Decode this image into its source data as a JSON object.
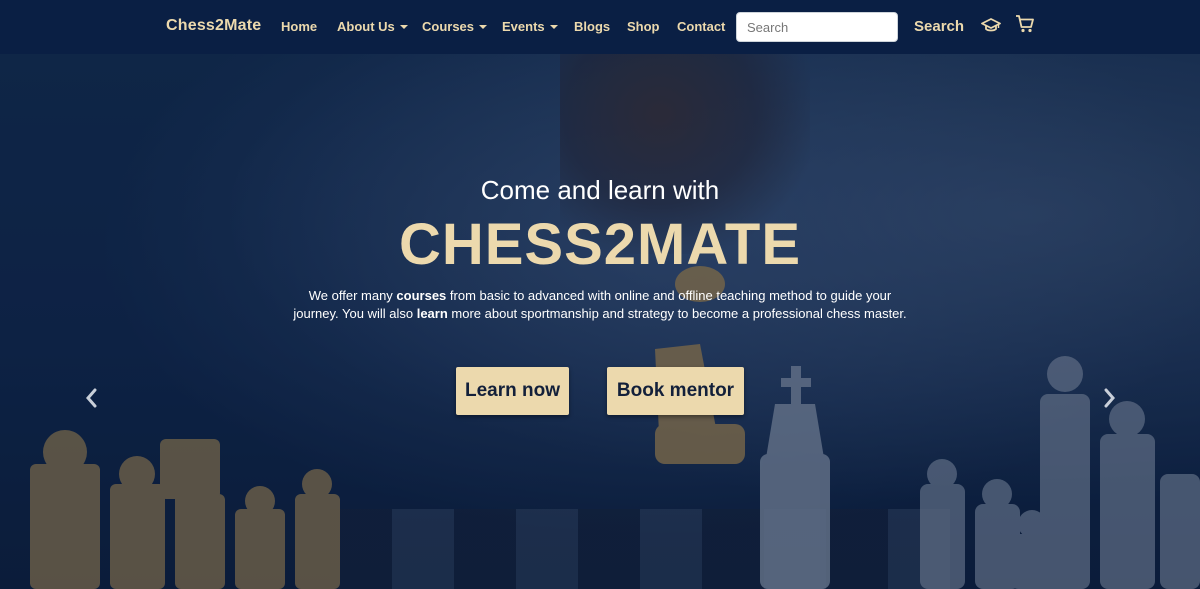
{
  "navbar": {
    "brand": "Chess2Mate",
    "items": [
      {
        "label": "Home"
      },
      {
        "label": "About Us"
      },
      {
        "label": "Courses"
      },
      {
        "label": "Events"
      },
      {
        "label": "Blogs"
      },
      {
        "label": "Shop"
      },
      {
        "label": "Contact"
      }
    ],
    "search": {
      "placeholder": "Search",
      "button_label": "Search"
    },
    "icons": [
      "graduation-cap-icon",
      "cart-icon"
    ]
  },
  "hero": {
    "subtitle": "Come and learn with",
    "title": "CHESS2MATE",
    "description": {
      "part1": "We offer many ",
      "bold1": "courses",
      "part2": " from basic to advanced with online and offline teaching method to guide your journey. You will also ",
      "bold2": "learn",
      "part3": " more about sportmanship and strategy to become a professional chess master."
    },
    "buttons": {
      "learn_now": "Learn now",
      "book_mentor": "Book mentor"
    },
    "carousel": {
      "prev_icon": "chevron-left-icon",
      "next_icon": "chevron-right-icon"
    }
  },
  "colors": {
    "navbar_bg": "#0a1f44",
    "accent": "#ecd9ad",
    "hero_text": "#ffffff"
  }
}
